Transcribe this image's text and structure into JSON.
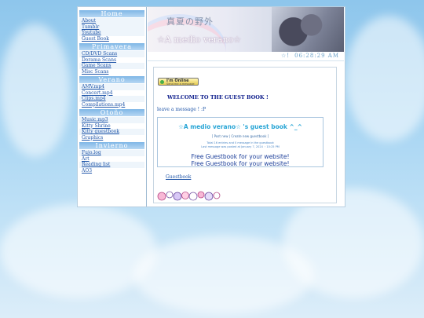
{
  "sidebar": {
    "sections": [
      {
        "title": "Home",
        "links": [
          "About",
          "Tumblr",
          "Youtube",
          "Guest Book"
        ]
      },
      {
        "title": "Primavera",
        "links": [
          "CD/DVD Scans",
          "Dorama Scans",
          "Game Scans",
          "Misc Scans"
        ]
      },
      {
        "title": "Verano",
        "links": [
          "AMV.mp4",
          "Concert.mp4",
          "Clips.mp4",
          "Compilations.mp4"
        ]
      },
      {
        "title": "Otoño",
        "links": [
          "Music.mp3",
          "Kitty Shrine",
          "Kitty guestbook",
          "Graphics"
        ]
      },
      {
        "title": "Invierno",
        "links": [
          "Fujo.log",
          "Art",
          "Reading list",
          "AO3"
        ]
      }
    ]
  },
  "banner": {
    "japanese_title": "真夏の野外",
    "site_title": "☆A medio verano☆"
  },
  "clock": {
    "time": "06:28:29 AM",
    "star": "☆!"
  },
  "online_badge": {
    "line1": "I'm Online",
    "line2": "Send me a message"
  },
  "content": {
    "welcome": "WELCOME TO THE GUEST BOOK !",
    "leave_message": "leave a message ! :P",
    "guestbook": {
      "title": "☆A medio verano☆ 's guest book ^_^",
      "links": "[ Post new | Create new guestbook ]",
      "stats1": "Total 16 entries and 0 message in the guestbook",
      "stats2": "Last message was posted at January 7, 2024 ・10:25 PM",
      "free1": "Free Guestbook for your website!",
      "free2": "Free Guestbook for your website!"
    },
    "guestbook_link": "Guestbook"
  },
  "colors": {
    "accent": "#7fb6e6",
    "link": "#1f55a8",
    "welcome": "#0a1a8a",
    "guestbook_title": "#2aa6d6"
  }
}
